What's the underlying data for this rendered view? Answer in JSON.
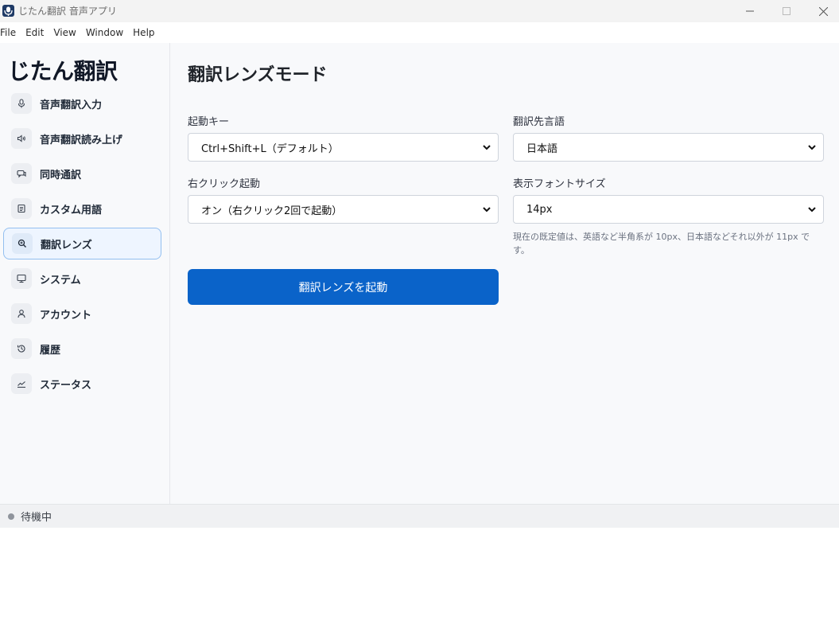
{
  "window": {
    "title": "じたん翻訳 音声アプリ"
  },
  "menu": {
    "items": [
      "File",
      "Edit",
      "View",
      "Window",
      "Help"
    ]
  },
  "sidebar": {
    "brand": "じたん翻訳",
    "items": [
      {
        "label": "音声翻訳入力",
        "icon": "microphone-icon",
        "active": false
      },
      {
        "label": "音声翻訳読み上げ",
        "icon": "speaker-icon",
        "active": false
      },
      {
        "label": "同時通訳",
        "icon": "chat-icon",
        "active": false
      },
      {
        "label": "カスタム用語",
        "icon": "document-icon",
        "active": false
      },
      {
        "label": "翻訳レンズ",
        "icon": "zoom-lens-icon",
        "active": true
      },
      {
        "label": "システム",
        "icon": "monitor-icon",
        "active": false
      },
      {
        "label": "アカウント",
        "icon": "user-icon",
        "active": false
      },
      {
        "label": "履歴",
        "icon": "history-icon",
        "active": false
      },
      {
        "label": "ステータス",
        "icon": "chart-line-icon",
        "active": false
      }
    ]
  },
  "main": {
    "title": "翻訳レンズモード",
    "launch_key": {
      "label": "起動キー",
      "value": "Ctrl+Shift+L（デフォルト）"
    },
    "target_language": {
      "label": "翻訳先言語",
      "value": "日本語"
    },
    "right_click": {
      "label": "右クリック起動",
      "value": "オン（右クリック2回で起動）"
    },
    "font_size": {
      "label": "表示フォントサイズ",
      "value": "14px"
    },
    "font_hint": "現在の既定値は、英語など半角系が 10px、日本語などそれ以外が 11px です。",
    "launch_button": "翻訳レンズを起動"
  },
  "status": {
    "text": "待機中"
  },
  "colors": {
    "accent": "#0a63c9",
    "active_border": "#93bff0",
    "active_bg": "#eef5ff"
  }
}
